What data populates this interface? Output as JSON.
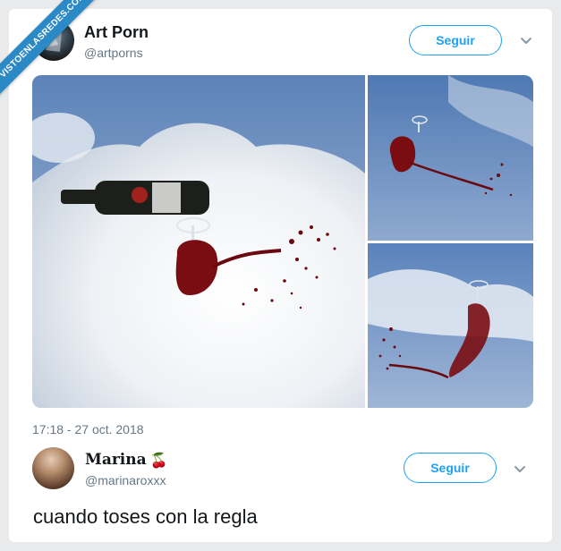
{
  "tweet": {
    "author": {
      "display_name": "Art Porn",
      "handle": "@artporns",
      "follow_label": "Seguir"
    },
    "timestamp": "17:18 - 27 oct. 2018",
    "media": [
      {
        "description_icon": "wine-bottle-pouring-image"
      },
      {
        "description_icon": "wine-glass-spill-image"
      },
      {
        "description_icon": "wine-glass-splash-image"
      }
    ]
  },
  "reply": {
    "author": {
      "display_name": "Marina",
      "emoji": "🍒",
      "handle": "@marinaroxxx",
      "follow_label": "Seguir"
    },
    "text": "cuando toses con la regla"
  },
  "watermark": {
    "text": "VISTOENLASREDES.COM"
  },
  "colors": {
    "accent": "#1da1f2",
    "ribbon": "#2b89c6",
    "secondary_text": "#657786"
  }
}
